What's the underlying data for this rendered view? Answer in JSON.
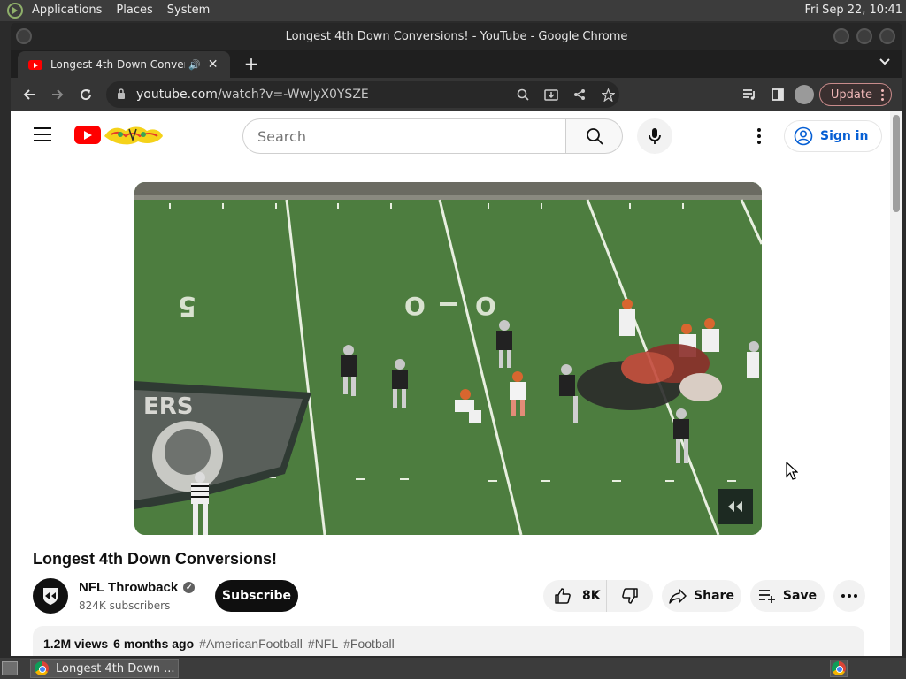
{
  "top_panel": {
    "menus": [
      "Applications",
      "Places",
      "System"
    ],
    "clock": "Fri Sep 22, 10:41"
  },
  "window": {
    "title": "Longest 4th Down Conversions! - YouTube - Google Chrome"
  },
  "tab": {
    "title": "Longest 4th Down Conversions! - YouTube",
    "audio_icon": "speaker-icon",
    "close_icon": "close-icon"
  },
  "toolbar": {
    "url_host": "youtube.com",
    "url_path": "/watch?v=-WwJyX0YSZE",
    "update_label": "Update"
  },
  "youtube": {
    "search_placeholder": "Search",
    "signin_label": "Sign in",
    "video_title": "Longest 4th Down Conversions!",
    "channel_name": "NFL Throwback",
    "subscribers": "824K subscribers",
    "subscribe_label": "Subscribe",
    "like_count": "8K",
    "share_label": "Share",
    "save_label": "Save",
    "views": "1.2M views",
    "age": "6 months ago",
    "hashtags": [
      "#AmericanFootball",
      "#NFL",
      "#Football"
    ]
  },
  "taskbar": {
    "window_item": "Longest 4th Down ..."
  },
  "colors": {
    "yt_red": "#ff0000",
    "link_blue": "#065fd4",
    "field_green": "#4a7a3c"
  }
}
